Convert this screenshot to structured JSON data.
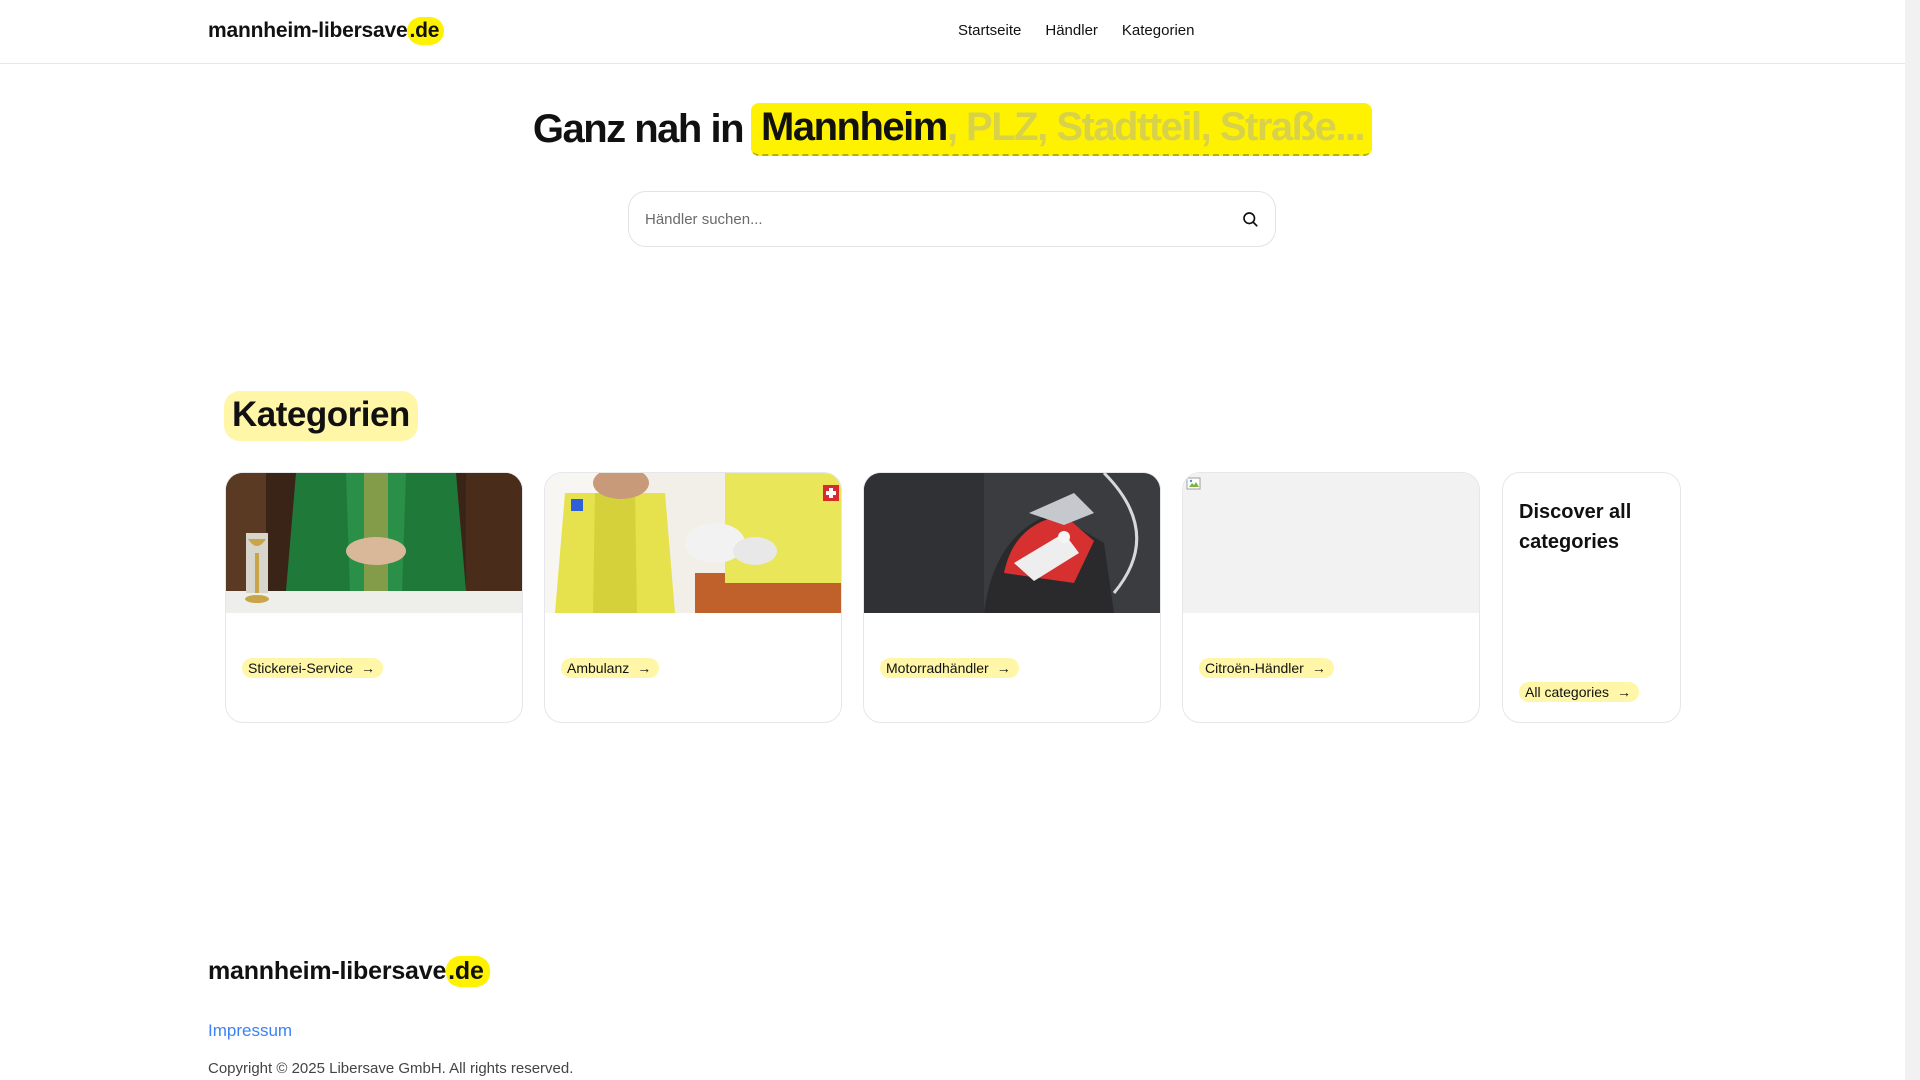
{
  "header": {
    "logo_name": "mannheim-libersave",
    "logo_tld": ".de",
    "nav": [
      "Startseite",
      "Händler",
      "Kategorien"
    ]
  },
  "hero": {
    "prefix": "Ganz nah in",
    "highlight": "Mannheim",
    "rest": ", PLZ, Stadtteil, Straße..."
  },
  "search": {
    "placeholder": "Händler suchen..."
  },
  "categories": {
    "heading": "Kategorien",
    "cards": [
      {
        "label": "Stickerei-Service",
        "arrow": "→"
      },
      {
        "label": "Ambulanz",
        "arrow": "→"
      },
      {
        "label": "Motorradhändler",
        "arrow": "→"
      },
      {
        "label": "Citroën-Händler",
        "arrow": "→"
      }
    ],
    "discover": {
      "title": "Discover all categories",
      "link": "All categories",
      "arrow": "→"
    }
  },
  "footer": {
    "logo_name": "mannheim-libersave",
    "logo_tld": ".de",
    "impressum": "Impressum",
    "copyright": "Copyright © 2025 Libersave GmbH. All rights reserved."
  },
  "colors": {
    "accent": "#fff200",
    "accent_soft": "#fff6a8",
    "link": "#3b82f6"
  }
}
